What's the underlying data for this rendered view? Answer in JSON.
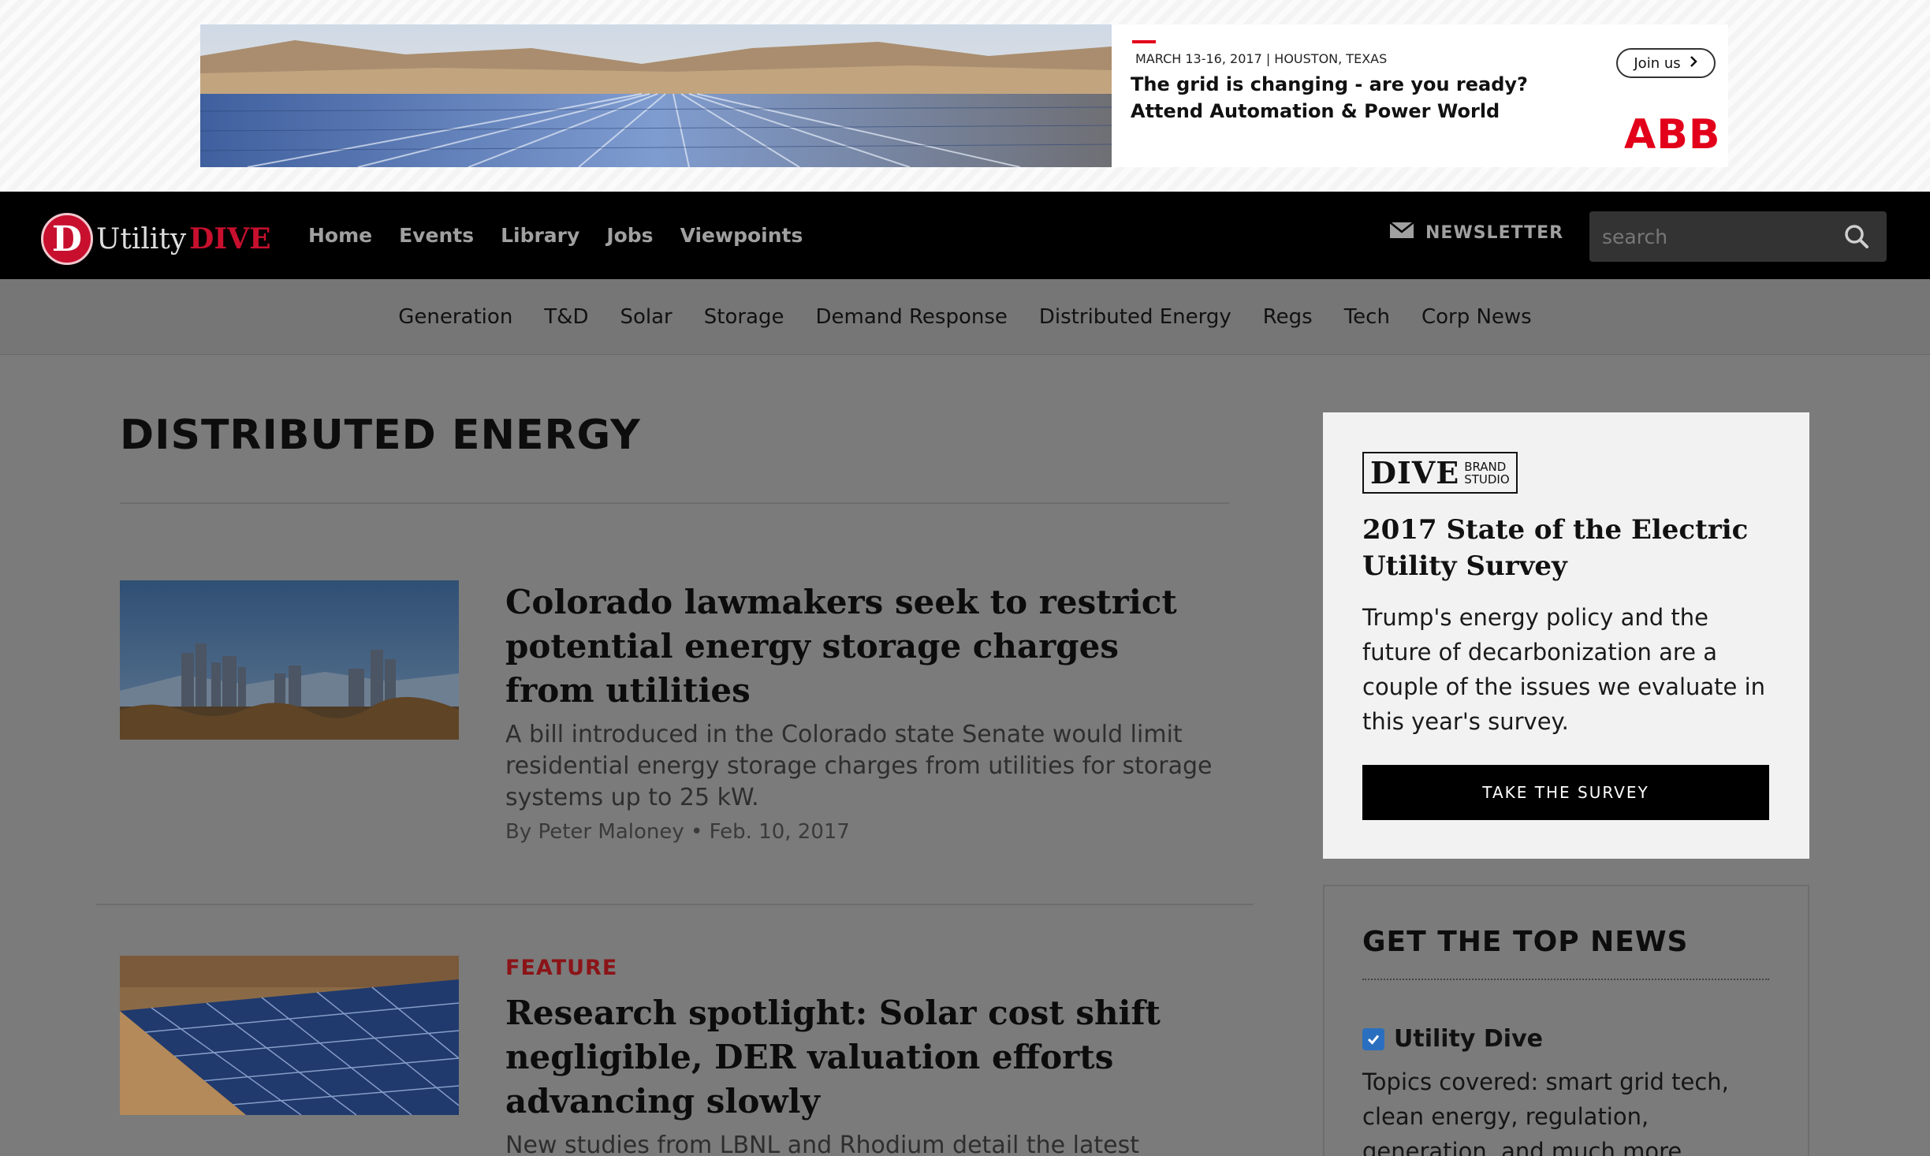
{
  "ad": {
    "date_location": "MARCH 13-16, 2017 | HOUSTON, TEXAS",
    "headline_1": "The grid is changing - are you ready?",
    "headline_2": "Attend Automation & Power World",
    "cta": "Join us",
    "brand": "ABB",
    "colors": {
      "brand": "#e2001a"
    }
  },
  "header": {
    "logo": {
      "letter": "D",
      "utility": "Utility",
      "dive": "DIVE"
    },
    "nav": [
      "Home",
      "Events",
      "Library",
      "Jobs",
      "Viewpoints"
    ],
    "newsletter_label": "NEWSLETTER",
    "search": {
      "placeholder": "search",
      "value": ""
    },
    "icons": {
      "newsletter": "envelope-icon",
      "search": "search-icon"
    }
  },
  "subnav": [
    "Generation",
    "T&D",
    "Solar",
    "Storage",
    "Demand Response",
    "Distributed Energy",
    "Regs",
    "Tech",
    "Corp News"
  ],
  "main": {
    "page_title": "DISTRIBUTED ENERGY",
    "articles": [
      {
        "label": "",
        "headline": "Colorado lawmakers seek to restrict potential energy storage charges from utilities",
        "dek": "A bill introduced in the Colorado state Senate would limit residential energy storage charges from utilities for storage systems up to 25 kW.",
        "author": "By Peter Maloney",
        "date": "Feb. 10, 2017"
      },
      {
        "label": "FEATURE",
        "headline": "Research spotlight: Solar cost shift negligible, DER valuation efforts advancing slowly",
        "dek": "New studies from LBNL and Rhodium detail the latest findings",
        "author": "",
        "date": ""
      }
    ]
  },
  "sidebar": {
    "survey": {
      "brand_main": "DIVE",
      "brand_sub_1": "BRAND",
      "brand_sub_2": "STUDIO",
      "title": "2017 State of the Electric Utility Survey",
      "text": "Trump's energy policy and the future of decarbonization are a couple of the issues we evaluate in this year's survey.",
      "button": "TAKE THE SURVEY"
    },
    "top_news": {
      "title": "GET THE TOP NEWS",
      "checkbox_label": "Utility Dive",
      "checked": true,
      "topics": "Topics covered: smart grid tech, clean energy, regulation, generation, and much more."
    }
  },
  "colors": {
    "accent": "#c8102e",
    "overlay": "#7b7b7b",
    "feature_label": "#8b1418",
    "checkbox": "#2a6fbf"
  }
}
